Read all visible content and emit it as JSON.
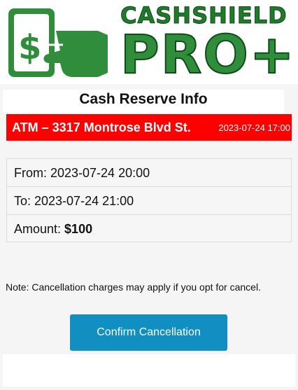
{
  "brand": {
    "name_top": "CASHSHIELD",
    "name_bottom": "PRO+",
    "colors": {
      "green": "#2f8d3b",
      "dark_green": "#1f7a2b",
      "accent_blue": "#118fc2",
      "banner_red": "#ff0000"
    }
  },
  "card": {
    "title": "Cash Reserve Info"
  },
  "banner": {
    "atm_label": "ATM –  3317 Montrose Blvd St.",
    "timestamp": "2023-07-24 17:00"
  },
  "details": {
    "from": "From: 2023-07-24 20:00",
    "to": "To: 2023-07-24 21:00",
    "amount_label": "Amount: ",
    "amount_value": "$100"
  },
  "note": "Note: Cancellation charges may apply if you opt for cancel.",
  "actions": {
    "confirm_label": "Confirm Cancellation"
  }
}
